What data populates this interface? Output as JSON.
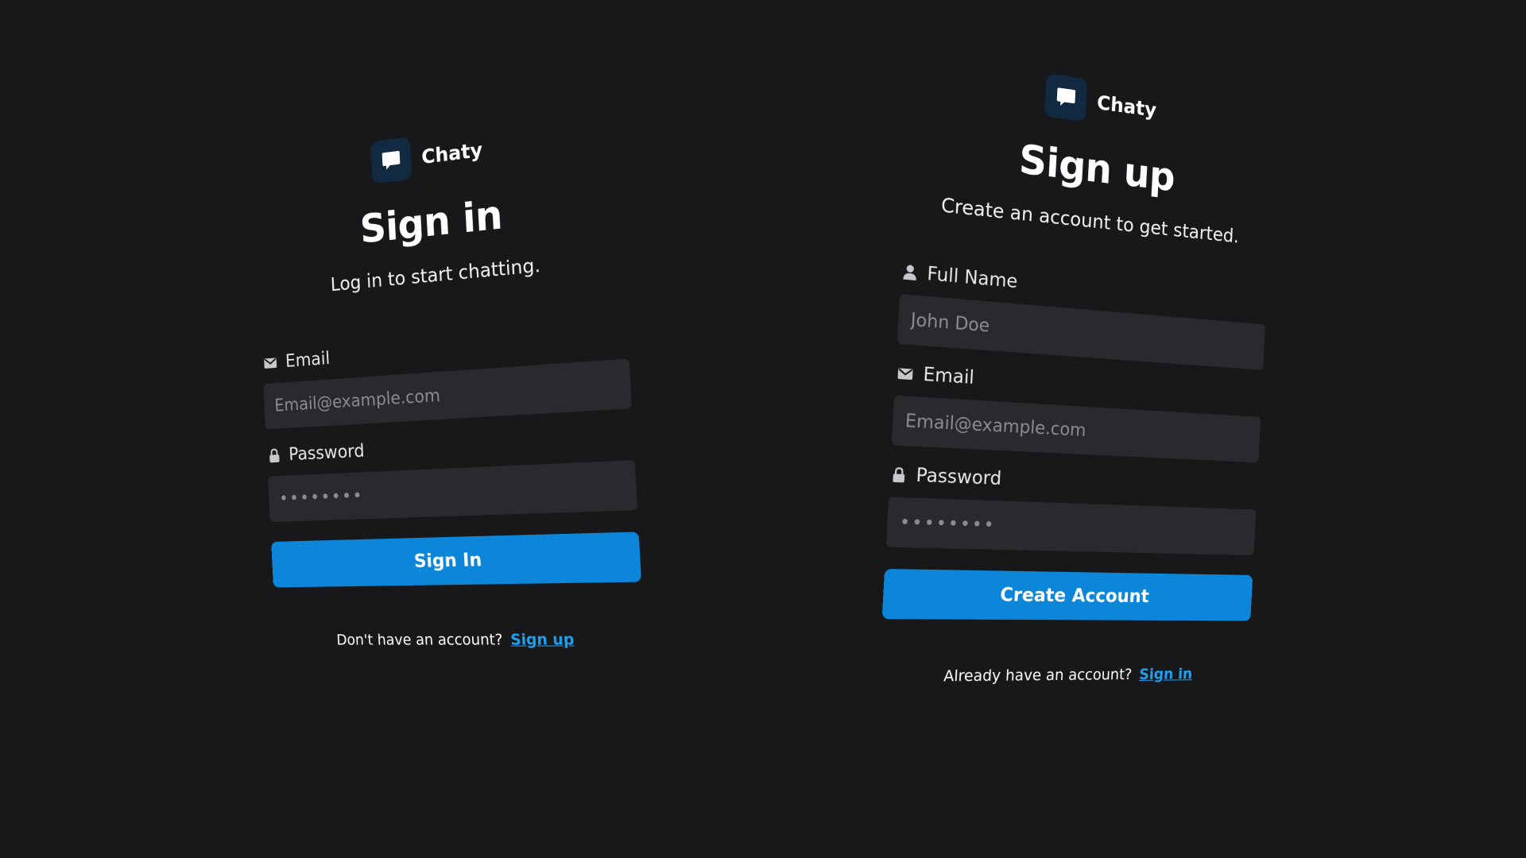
{
  "colors": {
    "background": "#18181b",
    "input_bg": "#2a2a2e",
    "accent": "#0c86d9",
    "link": "#1ea0f0",
    "logo_bg": "#112a41"
  },
  "signin": {
    "brand": {
      "name": "Chaty",
      "logo_icon": "chat-bubble-icon"
    },
    "title": "Sign in",
    "subtitle": "Log in to start chatting.",
    "email": {
      "label": "Email",
      "icon": "envelope-icon",
      "placeholder": "Email@example.com",
      "value": ""
    },
    "password": {
      "label": "Password",
      "icon": "lock-icon",
      "placeholder": "••••••••",
      "value": ""
    },
    "submit_label": "Sign In",
    "footer": {
      "prompt": "Don't have an account?",
      "link": "Sign up"
    }
  },
  "signup": {
    "brand": {
      "name": "Chaty",
      "logo_icon": "chat-bubble-icon"
    },
    "title": "Sign up",
    "subtitle": "Create an account to get started.",
    "full_name": {
      "label": "Full Name",
      "icon": "user-icon",
      "placeholder": "John Doe",
      "value": ""
    },
    "email": {
      "label": "Email",
      "icon": "envelope-icon",
      "placeholder": "Email@example.com",
      "value": ""
    },
    "password": {
      "label": "Password",
      "icon": "lock-icon",
      "placeholder": "••••••••",
      "value": ""
    },
    "submit_label": "Create Account",
    "footer": {
      "prompt": "Already have an account?",
      "link": "Sign in"
    }
  }
}
